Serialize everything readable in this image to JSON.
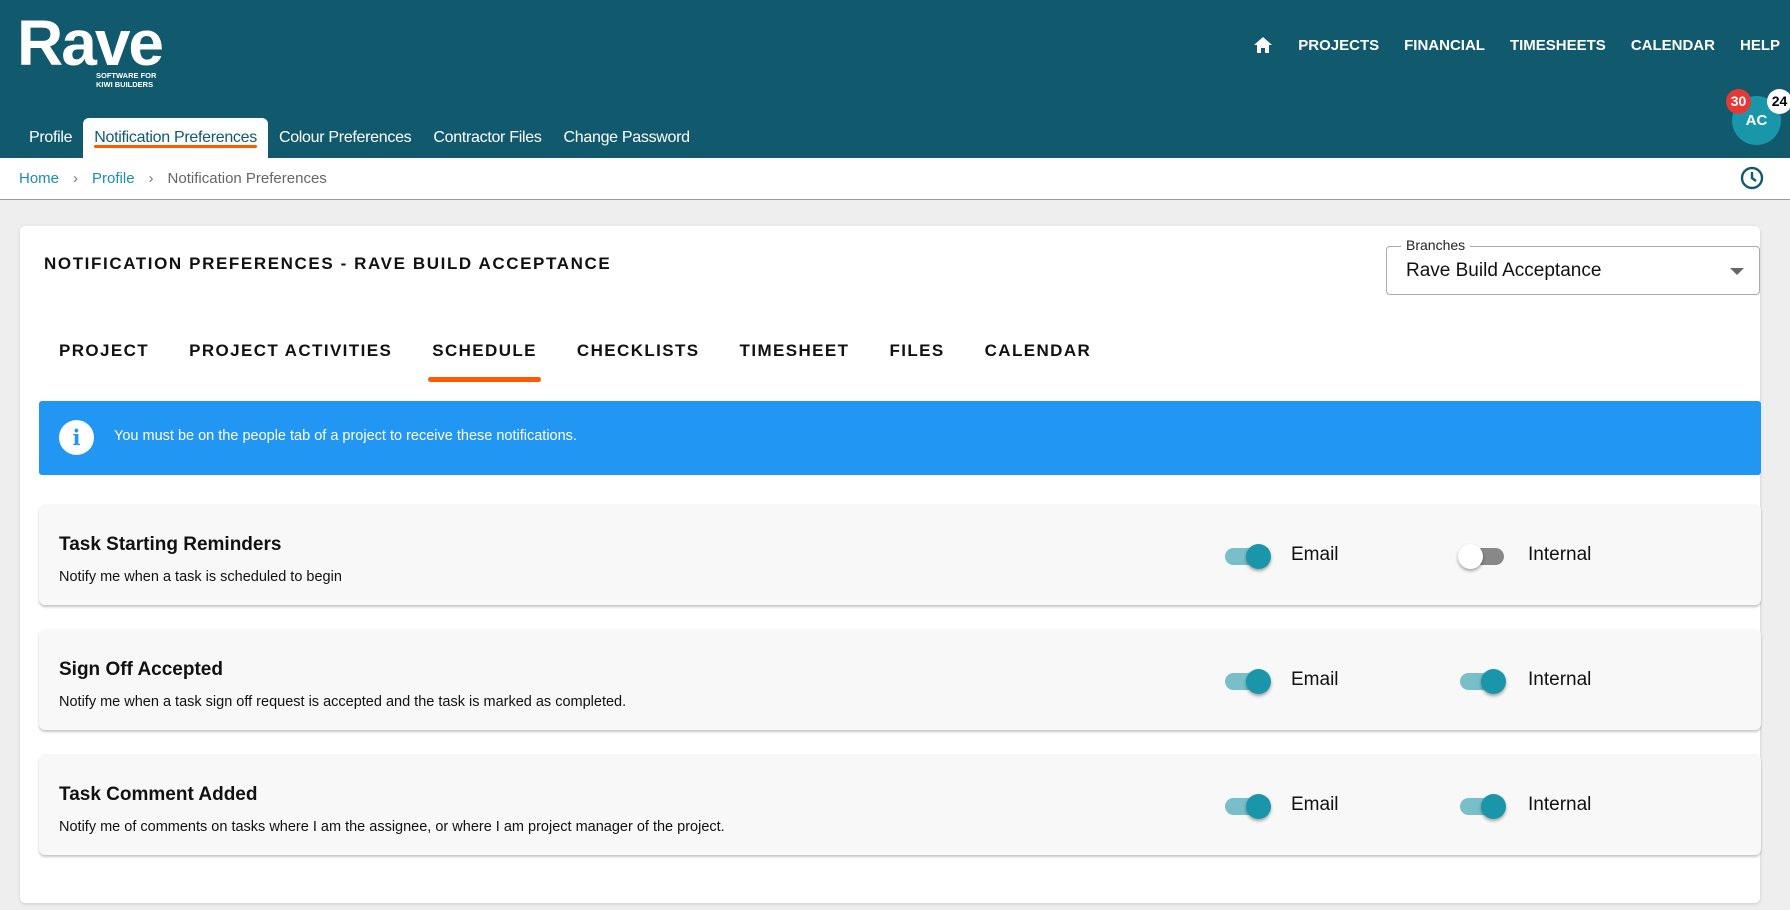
{
  "logo": {
    "name": "Rave",
    "tagline1": "SOFTWARE FOR",
    "tagline2": "KIWI BUILDERS"
  },
  "topnav": [
    "PROJECTS",
    "FINANCIAL",
    "TIMESHEETS",
    "CALENDAR",
    "HELP"
  ],
  "subtabs": [
    "Profile",
    "Notification Preferences",
    "Colour Preferences",
    "Contractor Files",
    "Change Password"
  ],
  "user": {
    "initials": "AC",
    "badge_red": "30",
    "badge_white": "24"
  },
  "breadcrumb": {
    "home": "Home",
    "profile": "Profile",
    "current": "Notification Preferences",
    "sep": "›"
  },
  "page": {
    "title": "NOTIFICATION PREFERENCES - RAVE BUILD ACCEPTANCE",
    "branches_label": "Branches",
    "branches_value": "Rave Build Acceptance"
  },
  "tabs": [
    "PROJECT",
    "PROJECT ACTIVITIES",
    "SCHEDULE",
    "CHECKLISTS",
    "TIMESHEET",
    "FILES",
    "CALENDAR"
  ],
  "active_tab": "SCHEDULE",
  "info": {
    "icon": "i",
    "text": "You must be on the people tab of a project to receive these notifications."
  },
  "labels": {
    "email": "Email",
    "internal": "Internal"
  },
  "rows": [
    {
      "title": "Task Starting Reminders",
      "desc": "Notify me when a task is scheduled to begin",
      "email": true,
      "internal": false
    },
    {
      "title": "Sign Off Accepted",
      "desc": "Notify me when a task sign off request is accepted and the task is marked as completed.",
      "email": true,
      "internal": true
    },
    {
      "title": "Task Comment Added",
      "desc": "Notify me of comments on tasks where I am the assignee, or where I am project manager of the project.",
      "email": true,
      "internal": true
    }
  ],
  "colors": {
    "header": "#115a6d",
    "accent": "#ff5a00",
    "info": "#2196f3",
    "toggle": "#1a96ab"
  }
}
